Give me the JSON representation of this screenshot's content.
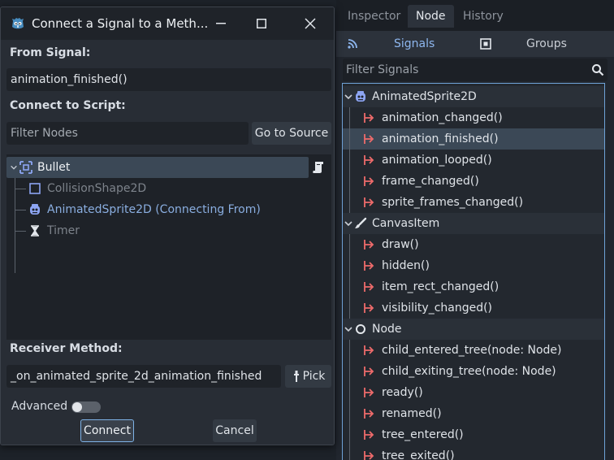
{
  "dock": {
    "tabs": [
      "Inspector",
      "Node",
      "History"
    ],
    "active_tab": "Node",
    "subtabs": {
      "signals": "Signals",
      "groups": "Groups"
    },
    "filter_placeholder": "Filter Signals"
  },
  "signals": {
    "sections": [
      {
        "name": "AnimatedSprite2D",
        "icon": "animated-sprite-icon",
        "items": [
          "animation_changed()",
          "animation_finished()",
          "animation_looped()",
          "frame_changed()",
          "sprite_frames_changed()"
        ]
      },
      {
        "name": "CanvasItem",
        "icon": "brush-icon",
        "items": [
          "draw()",
          "hidden()",
          "item_rect_changed()",
          "visibility_changed()"
        ]
      },
      {
        "name": "Node",
        "icon": "node-circle-icon",
        "items": [
          "child_entered_tree(node: Node)",
          "child_exiting_tree(node: Node)",
          "ready()",
          "renamed()",
          "tree_entered()",
          "tree_exited()"
        ]
      }
    ],
    "selected": "animation_finished()"
  },
  "dialog": {
    "title": "Connect a Signal to a Meth...",
    "from_signal_label": "From Signal:",
    "from_signal_value": "animation_finished()",
    "connect_to_script_label": "Connect to Script:",
    "filter_nodes_placeholder": "Filter Nodes",
    "go_to_source": "Go to Source",
    "nodes": [
      {
        "name": "Bullet",
        "icon": "node2d-icon"
      },
      {
        "name": "CollisionShape2D",
        "icon": "collision-shape-icon"
      },
      {
        "name": "AnimatedSprite2D (Connecting From)",
        "icon": "animated-sprite-icon"
      },
      {
        "name": "Timer",
        "icon": "timer-icon"
      }
    ],
    "receiver_method_label": "Receiver Method:",
    "receiver_method_value": "_on_animated_sprite_2d_animation_finished",
    "pick_label": "Pick",
    "advanced_label": "Advanced",
    "advanced_on": false,
    "connect_label": "Connect",
    "cancel_label": "Cancel"
  },
  "colors": {
    "accent": "#8eb7ef",
    "signal_icon": "#ee6b6b",
    "node_icon": "#8da5f3",
    "selection": "#3b4856"
  }
}
